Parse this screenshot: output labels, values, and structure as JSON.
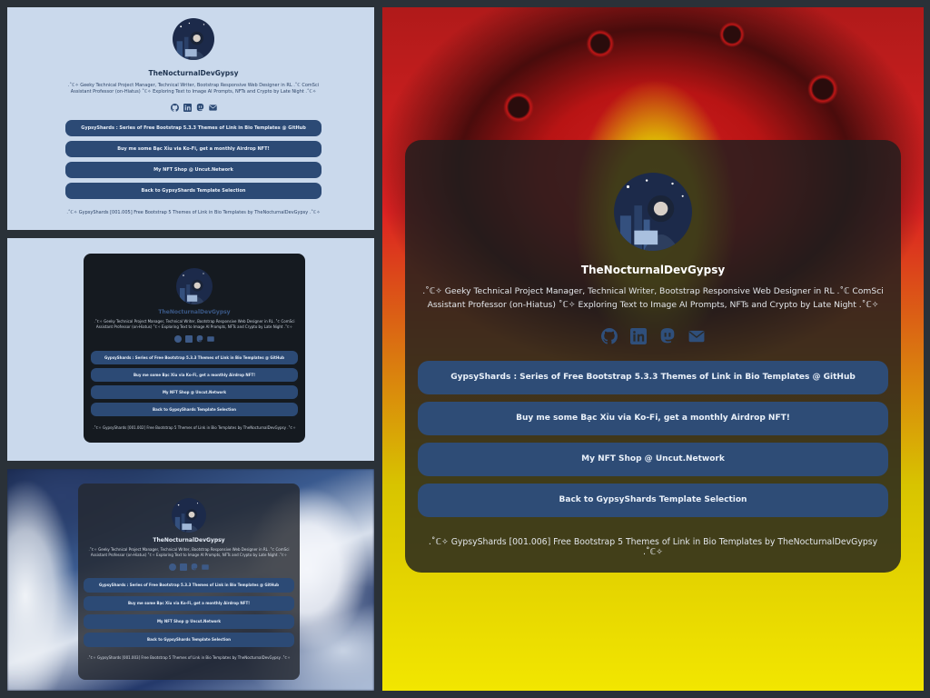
{
  "profile": {
    "name": "TheNocturnalDevGypsy",
    "bio": ".˚ℂ✧ Geeky Technical Project Manager, Technical Writer, Bootstrap Responsive Web Designer in RL .˚ℂ ComSci Assistant Professor (on-Hiatus) ˚ℂ✧ Exploring Text to Image AI Prompts, NFTs and Crypto by Late Night .˚ℂ✧"
  },
  "social_icons": [
    "github-icon",
    "linkedin-icon",
    "mastodon-icon",
    "email-icon"
  ],
  "buttons": [
    {
      "label": "GypsyShards : Series of Free Bootstrap 5.3.3 Themes of Link in Bio Templates @ GitHub"
    },
    {
      "label": "Buy me some Bạc Xỉu via Ko-Fi, get a monthly Airdrop NFT!"
    },
    {
      "label": "My NFT Shop @ Uncut.Network"
    },
    {
      "label": "Back to GypsyShards Template Selection"
    }
  ],
  "footers": {
    "theme_001_005": ".˚ℂ✧ GypsyShards [001.005] Free Bootstrap 5 Themes of Link in Bio Templates by TheNocturnalDevGypsy .˚ℂ✧",
    "theme_001_002": ".˚ℂ✧ GypsyShards [001.002] Free Bootstrap 5 Themes of Link in Bio Templates by TheNocturnalDevGypsy .˚ℂ✧",
    "theme_001_003": ".˚ℂ✧ GypsyShards [001.003] Free Bootstrap 5 Themes of Link in Bio Templates by TheNocturnalDevGypsy .˚ℂ✧",
    "theme_001_006": ".˚ℂ✧ GypsyShards [001.006] Free Bootstrap 5 Themes of Link in Bio Templates by TheNocturnalDevGypsy .˚ℂ✧"
  },
  "colors": {
    "button_bg": "#2c4a75",
    "light_bg": "#cad9ec",
    "dark_card": "#151a20",
    "accent_yellow": "#f2e600",
    "accent_red": "#c01616"
  }
}
